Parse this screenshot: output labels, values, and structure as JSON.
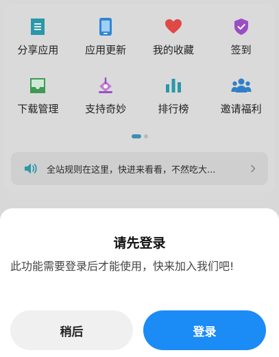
{
  "colors": {
    "accent": "#1b8bf5",
    "teal": "#2a98a9",
    "red": "#e04848",
    "purple": "#9a4ec4",
    "green": "#3f9a56"
  },
  "grid": {
    "items": [
      {
        "label": "分享应用",
        "icon": "share-doc-icon"
      },
      {
        "label": "应用更新",
        "icon": "phone-update-icon"
      },
      {
        "label": "我的收藏",
        "icon": "heart-icon"
      },
      {
        "label": "签到",
        "icon": "checkin-badge-icon"
      },
      {
        "label": "下载管理",
        "icon": "download-tray-icon"
      },
      {
        "label": "支持奇妙",
        "icon": "support-gift-icon"
      },
      {
        "label": "排行榜",
        "icon": "bar-chart-icon"
      },
      {
        "label": "邀请福利",
        "icon": "invite-people-icon"
      }
    ]
  },
  "notice": {
    "text": "全站规则在这里，快进来看看，不然吃大..."
  },
  "dialog": {
    "title": "请先登录",
    "message": "此功能需要登录后才能使用，快来加入我们吧!",
    "later_label": "稍后",
    "login_label": "登录"
  }
}
